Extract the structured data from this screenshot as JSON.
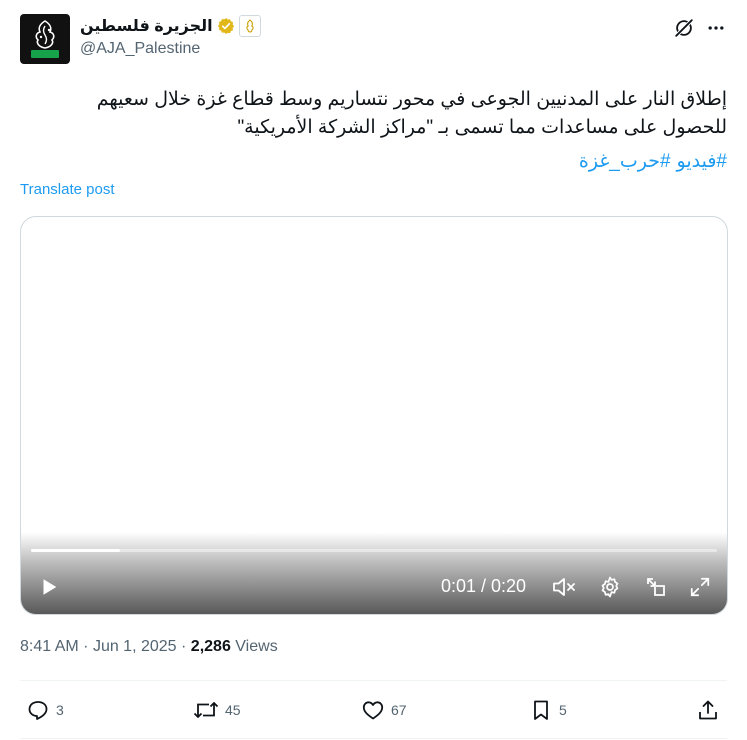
{
  "author": {
    "display_name": "الجزيرة فلسطين",
    "handle": "@AJA_Palestine",
    "verified_color": "#e2b719",
    "avatar_icon": "aljazeera-logo-icon",
    "avatar_badge_color": "#16a34a"
  },
  "header": {
    "grok_icon": "grok-icon",
    "more_icon": "more-icon"
  },
  "tweet": {
    "lines": [
      "إطلاق النار على المدنيين الجوعى في محور نتساريم وسط قطاع غزة خلال سعيهم",
      "للحصول على مساعدات مما تسمى بـ \"مراكز الشركة الأمريكية\""
    ],
    "hashtags": [
      "#فيديو",
      "#حرب_غزة"
    ],
    "translate_label": "Translate post"
  },
  "video": {
    "time_display": "0:01 / 0:20",
    "progress": 0.13,
    "controls": [
      "play-icon",
      "mute-icon",
      "settings-icon",
      "pop-out-icon",
      "fullscreen-icon"
    ]
  },
  "meta": {
    "time": "8:41 AM",
    "date": "Jun 1, 2025",
    "views_count": "2,286",
    "views_label": "Views"
  },
  "actions": {
    "replies": "3",
    "reposts": "45",
    "likes": "67",
    "bookmarks": "5"
  },
  "colors": {
    "link": "#1d9bf0",
    "muted": "#536471",
    "text": "#0f1419",
    "border": "#cfd9de"
  }
}
